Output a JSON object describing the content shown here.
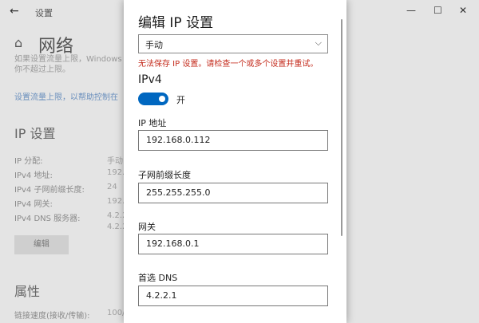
{
  "window": {
    "title": "设置",
    "back_icon": "back-arrow-icon",
    "controls": [
      "minimize-icon",
      "maximize-icon",
      "close-icon"
    ]
  },
  "background": {
    "heading": "网络",
    "note_line1": "如果设置流量上限，Windows",
    "note_line2": "你不超过上限。",
    "link": "设置流量上限，以帮助控制在",
    "ip_section": "IP 设置",
    "ip_rows": [
      {
        "label": "IP 分配:",
        "value": "手动"
      },
      {
        "label": "IPv4 地址:",
        "value": "192."
      },
      {
        "label": "IPv4 子网前缀长度:",
        "value": "24"
      },
      {
        "label": "IPv4 网关:",
        "value": "192."
      },
      {
        "label": "IPv4 DNS 服务器:",
        "value": "4.2.2"
      },
      {
        "label": "",
        "value": "4.2.2"
      }
    ],
    "edit_button": "编辑",
    "properties": "属性",
    "speed_label": "链接速度(接收/传输):",
    "speed_value": "100/"
  },
  "dialog": {
    "title": "编辑 IP 设置",
    "mode": "手动",
    "error": "无法保存 IP 设置。请检查一个或多个设置并重试。",
    "section": "IPv4",
    "toggle_label": "开",
    "toggle_on": true,
    "fields": [
      {
        "label": "IP 地址",
        "value": "192.168.0.112"
      },
      {
        "label": "子网前缀长度",
        "value": "255.255.255.0"
      },
      {
        "label": "网关",
        "value": "192.168.0.1"
      },
      {
        "label": "首选 DNS",
        "value": "4.2.2.1"
      }
    ]
  },
  "colors": {
    "accent": "#0067c0",
    "error": "#c42b1c",
    "link": "#6a8fbd"
  }
}
